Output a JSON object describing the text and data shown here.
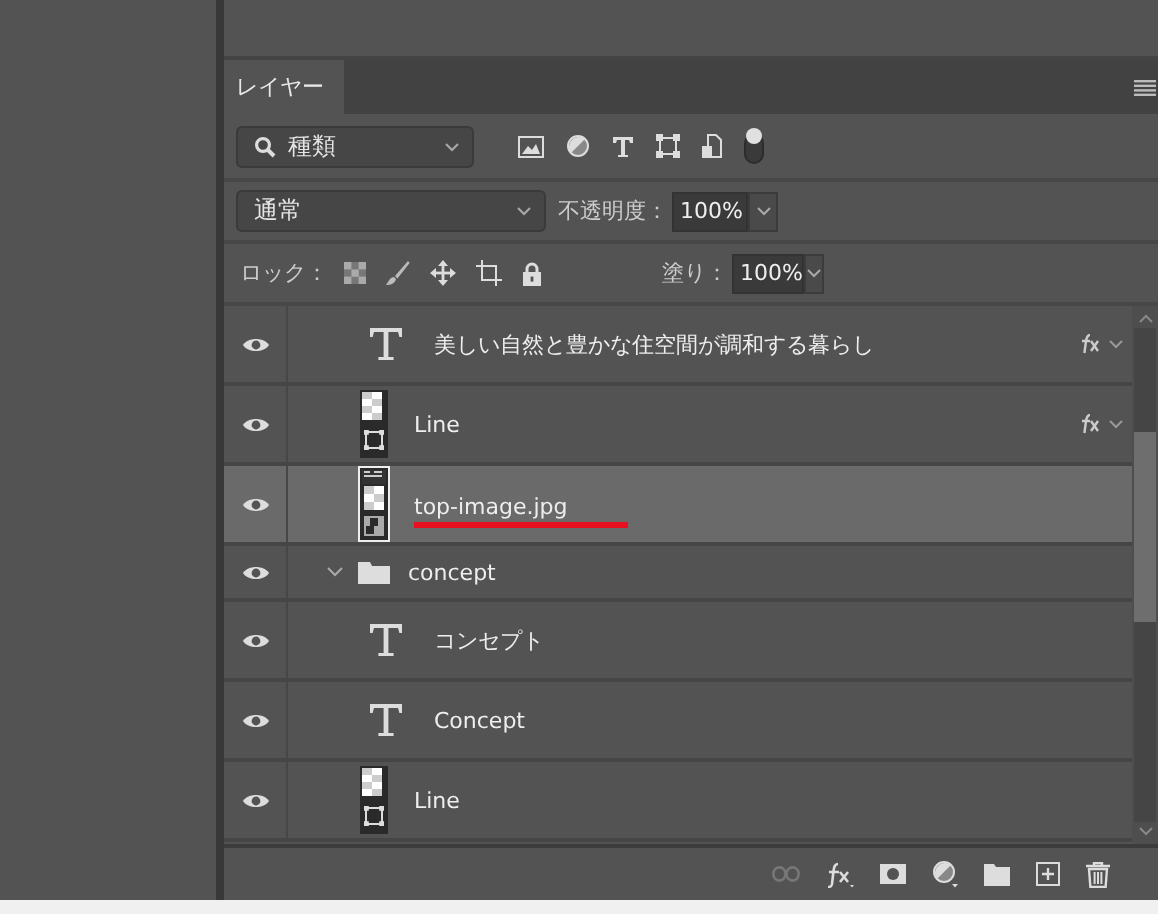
{
  "panel": {
    "tab": {
      "label": "レイヤー",
      "selected": true
    }
  },
  "filter": {
    "value": "種類"
  },
  "blend": {
    "value": "通常",
    "opacity_label": "不透明度：",
    "opacity": "100%"
  },
  "lock": {
    "label": "ロック：",
    "fill_label": "塗り：",
    "fill": "100%"
  },
  "layers": [
    {
      "kind": "text",
      "name": "美しい自然と豊かな住空間が調和する暮らし",
      "visible": true,
      "fx": true,
      "selected": false,
      "annotated": false
    },
    {
      "kind": "shape",
      "name": "Line",
      "visible": true,
      "fx": true,
      "selected": false,
      "annotated": false
    },
    {
      "kind": "smart",
      "name": "top-image.jpg",
      "visible": true,
      "fx": false,
      "selected": true,
      "annotated": true
    },
    {
      "kind": "group",
      "name": "concept",
      "visible": true,
      "fx": false,
      "selected": false,
      "annotated": false,
      "expanded": true,
      "children": [
        {
          "kind": "text",
          "name": "コンセプト",
          "visible": true,
          "fx": false,
          "selected": false,
          "annotated": false
        },
        {
          "kind": "text",
          "name": "Concept",
          "visible": true,
          "fx": false,
          "selected": false,
          "annotated": false
        },
        {
          "kind": "shape",
          "name": "Line",
          "visible": true,
          "fx": false,
          "selected": false,
          "annotated": false
        }
      ]
    }
  ]
}
